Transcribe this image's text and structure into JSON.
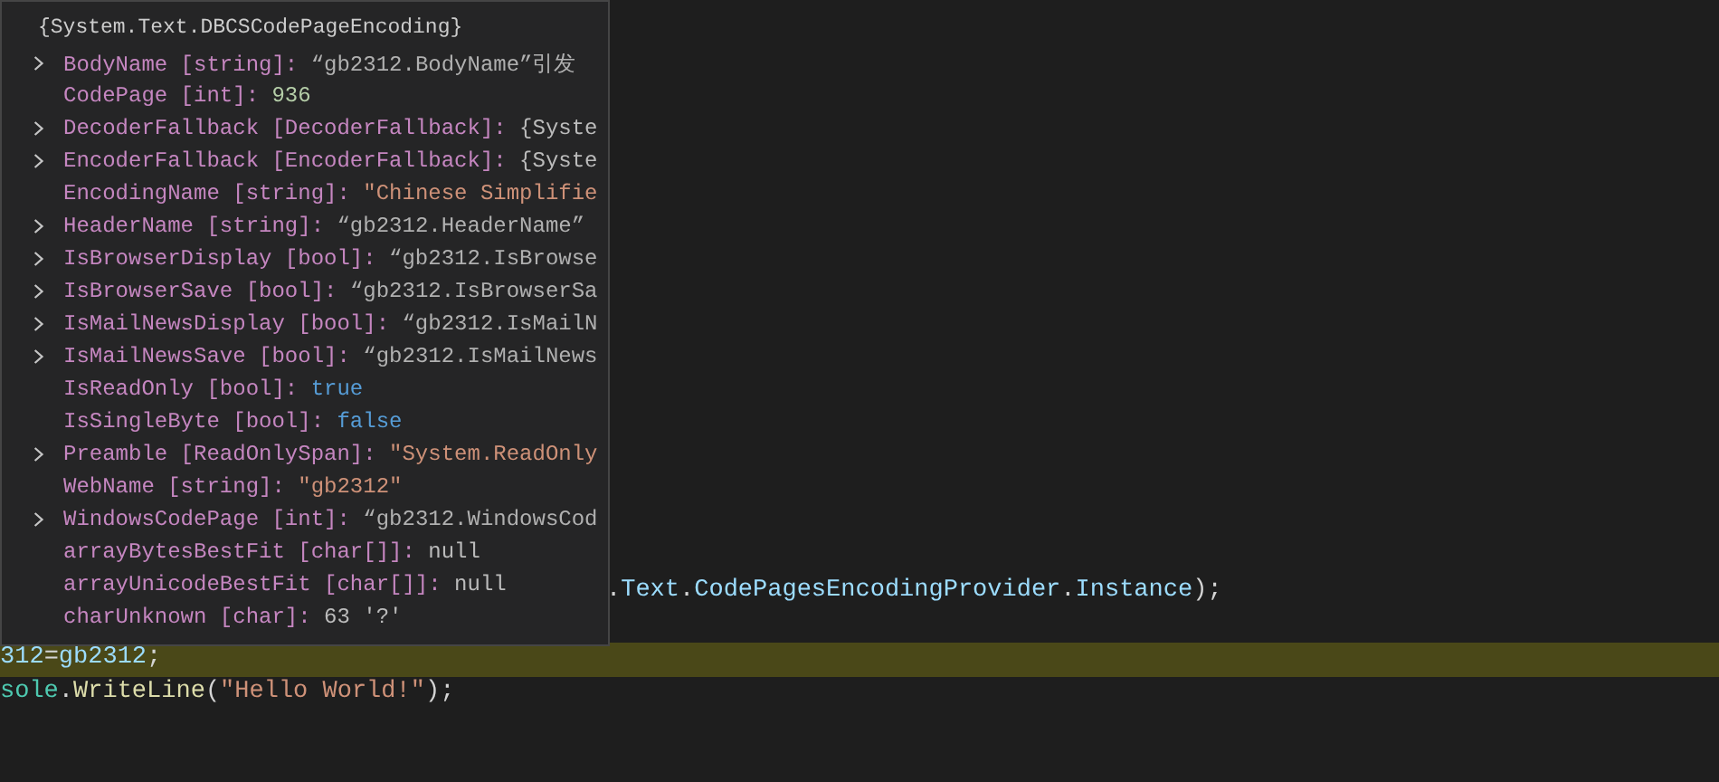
{
  "code_lines": [
    {
      "covered": true,
      "current": false,
      "tokens": [
        {
          "kind": "plain",
          "text": "."
        },
        {
          "kind": "variable",
          "text": "Text"
        },
        {
          "kind": "plain",
          "text": "."
        },
        {
          "kind": "variable",
          "text": "CodePagesEncodingProvider"
        },
        {
          "kind": "plain",
          "text": "."
        },
        {
          "kind": "variable",
          "text": "Instance"
        },
        {
          "kind": "plain",
          "text": ");"
        }
      ]
    },
    {
      "covered": false,
      "current": false
    },
    {
      "covered": false,
      "current": true,
      "tokens": [
        {
          "kind": "variable",
          "text": "312"
        },
        {
          "kind": "plain",
          "text": "="
        },
        {
          "kind": "variable",
          "text": "gb2312"
        },
        {
          "kind": "plain",
          "text": ";"
        }
      ]
    },
    {
      "covered": false,
      "current": false,
      "tokens": [
        {
          "kind": "class",
          "text": "sole"
        },
        {
          "kind": "plain",
          "text": "."
        },
        {
          "kind": "method",
          "text": "WriteLine"
        },
        {
          "kind": "plain",
          "text": "("
        },
        {
          "kind": "string",
          "text": "\"Hello World!\""
        },
        {
          "kind": "plain",
          "text": ");"
        }
      ]
    }
  ],
  "tooltip": {
    "title": "{System.Text.DBCSCodePageEncoding}",
    "rows": [
      {
        "name": "BodyName",
        "type": "[string]:",
        "value": "“gb2312.BodyName”引发",
        "kind": "message",
        "expandable": true
      },
      {
        "name": "CodePage",
        "type": "[int]:",
        "value": "936",
        "kind": "number",
        "expandable": false
      },
      {
        "name": "DecoderFallback",
        "type": "[DecoderFallback]:",
        "value": "{Syste",
        "kind": "plain",
        "expandable": true
      },
      {
        "name": "EncoderFallback",
        "type": "[EncoderFallback]:",
        "value": "{Syste",
        "kind": "plain",
        "expandable": true
      },
      {
        "name": "EncodingName",
        "type": "[string]:",
        "value": "\"Chinese Simplifie",
        "kind": "string",
        "expandable": false
      },
      {
        "name": "HeaderName",
        "type": "[string]:",
        "value": "“gb2312.HeaderName”",
        "kind": "message",
        "expandable": true
      },
      {
        "name": "IsBrowserDisplay",
        "type": "[bool]:",
        "value": "“gb2312.IsBrowse",
        "kind": "message",
        "expandable": true
      },
      {
        "name": "IsBrowserSave",
        "type": "[bool]:",
        "value": "“gb2312.IsBrowserSa",
        "kind": "message",
        "expandable": true
      },
      {
        "name": "IsMailNewsDisplay",
        "type": "[bool]:",
        "value": "“gb2312.IsMailN",
        "kind": "message",
        "expandable": true
      },
      {
        "name": "IsMailNewsSave",
        "type": "[bool]:",
        "value": "“gb2312.IsMailNews",
        "kind": "message",
        "expandable": true
      },
      {
        "name": "IsReadOnly",
        "type": "[bool]:",
        "value": "true",
        "kind": "keyword",
        "expandable": false
      },
      {
        "name": "IsSingleByte",
        "type": "[bool]:",
        "value": "false",
        "kind": "keyword",
        "expandable": false
      },
      {
        "name": "Preamble",
        "type": "[ReadOnlySpan]:",
        "value": "\"System.ReadOnly",
        "kind": "string",
        "expandable": true
      },
      {
        "name": "WebName",
        "type": "[string]:",
        "value": "\"gb2312\"",
        "kind": "string",
        "expandable": false
      },
      {
        "name": "WindowsCodePage",
        "type": "[int]:",
        "value": "“gb2312.WindowsCod",
        "kind": "message",
        "expandable": true
      },
      {
        "name": "arrayBytesBestFit",
        "type": "[char[]]:",
        "value": "null",
        "kind": "plain",
        "expandable": false
      },
      {
        "name": "arrayUnicodeBestFit",
        "type": "[char[]]:",
        "value": "null",
        "kind": "plain",
        "expandable": false
      },
      {
        "name": "charUnknown",
        "type": "[char]:",
        "value": "63 '?'",
        "kind": "plain",
        "expandable": false
      }
    ]
  }
}
